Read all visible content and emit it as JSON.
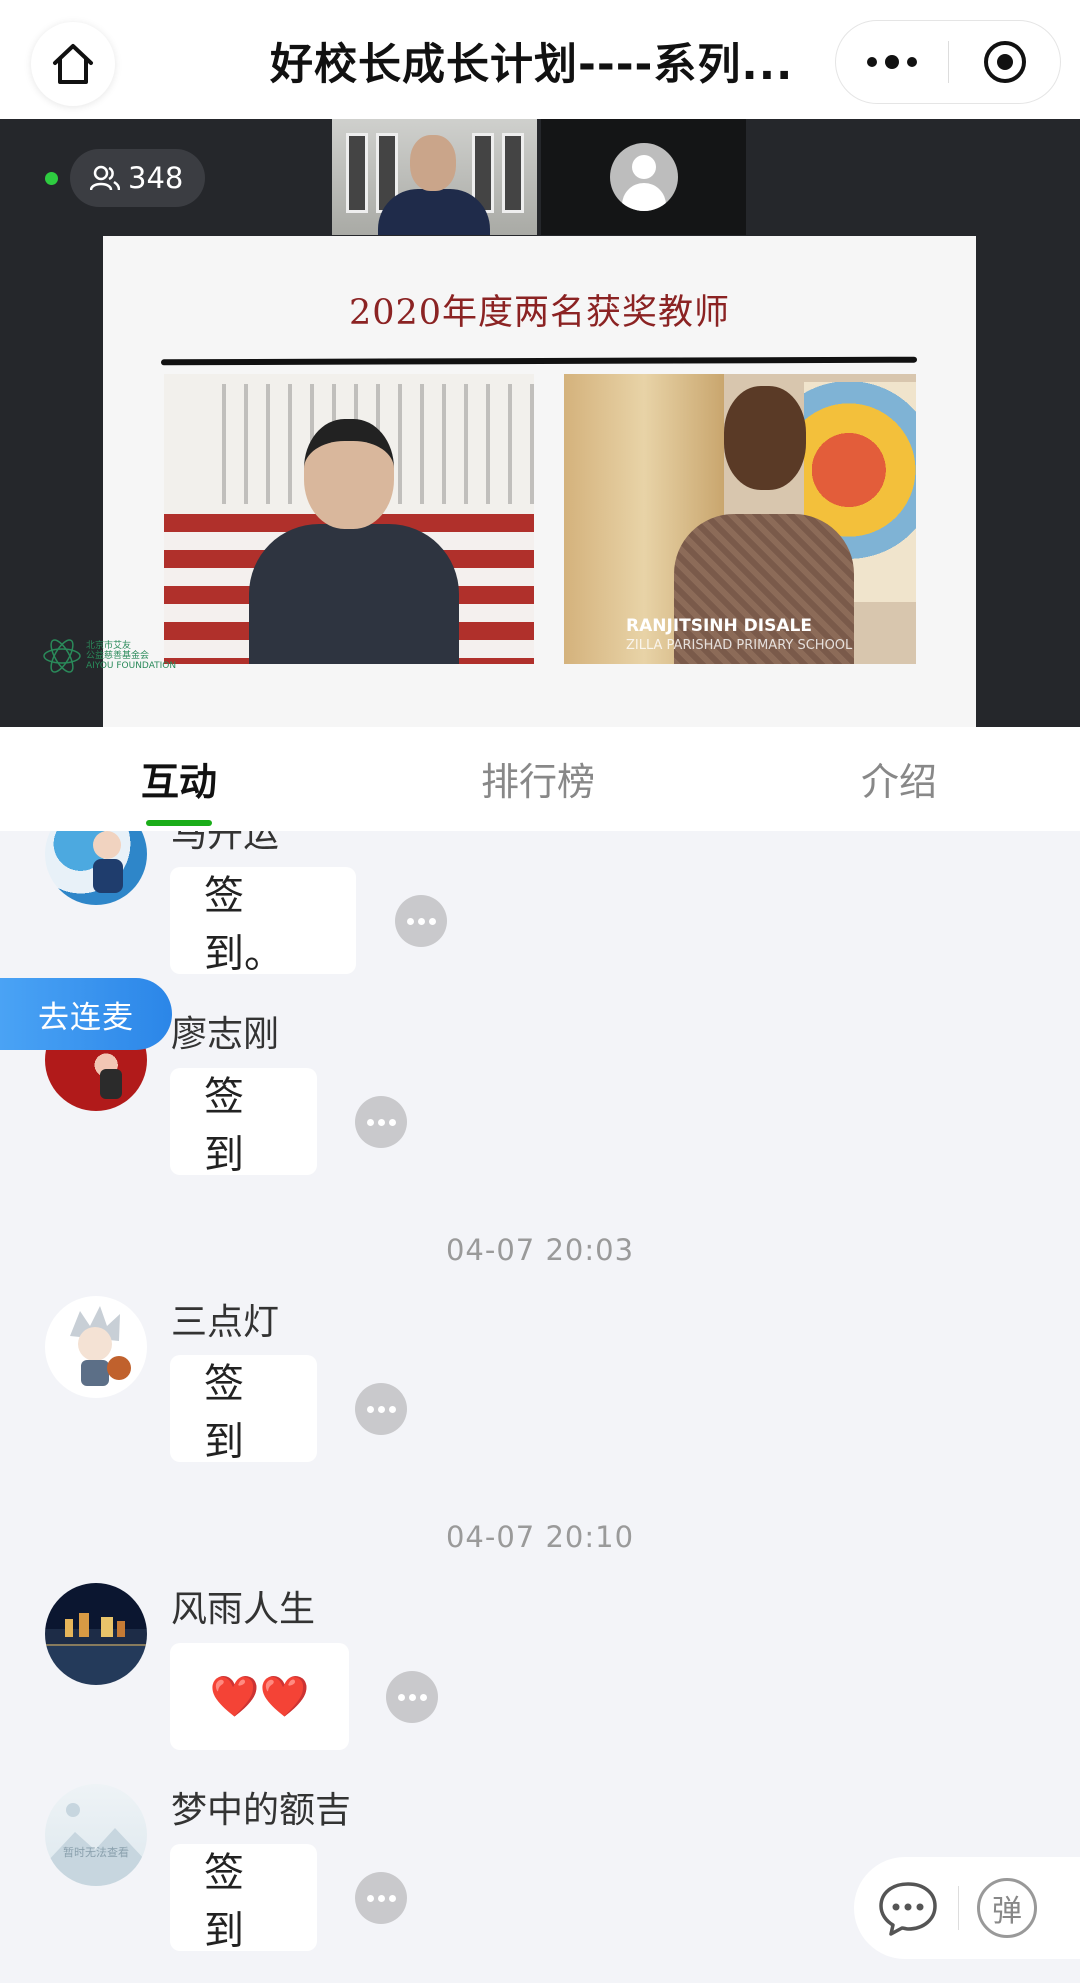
{
  "header": {
    "title": "好校长成长计划----系列...",
    "home_icon": "home-icon",
    "more_icon": "more-dots-icon",
    "close_icon": "target-close-icon"
  },
  "video": {
    "viewer_count": "348",
    "slide": {
      "title": "2020年度两名获奖教师",
      "caption_name": "RANJITSINH DISALE",
      "caption_school": "ZILLA PARISHAD PRIMARY SCHOOL",
      "logo_line1": "北京市艾友",
      "logo_line2": "公益慈善基金会",
      "logo_line3": "AIYOU FOUNDATION"
    }
  },
  "tabs": [
    {
      "label": "互动",
      "active": true
    },
    {
      "label": "排行榜",
      "active": false
    },
    {
      "label": "介绍",
      "active": false
    }
  ],
  "chat": {
    "messages": [
      {
        "name": "马开运",
        "text": "签到。"
      },
      {
        "name": "廖志刚",
        "text": "签到"
      },
      {
        "name": "三点灯",
        "text": "签到"
      },
      {
        "name": "风雨人生",
        "text": "❤️❤️"
      },
      {
        "name": "梦中的额吉",
        "text": "签到"
      }
    ],
    "timestamps": [
      "04-07 20:03",
      "04-07 20:10"
    ],
    "avatar_placeholder_text": "暂时无法查看",
    "mic_button": "去连麦"
  },
  "bottom_bar": {
    "chat_icon": "chat-bubble-icon",
    "danmu_label": "弹"
  },
  "colors": {
    "accent_green": "#1aad19",
    "mic_blue": "#2b86e8",
    "slide_title_red": "#8b2323"
  }
}
